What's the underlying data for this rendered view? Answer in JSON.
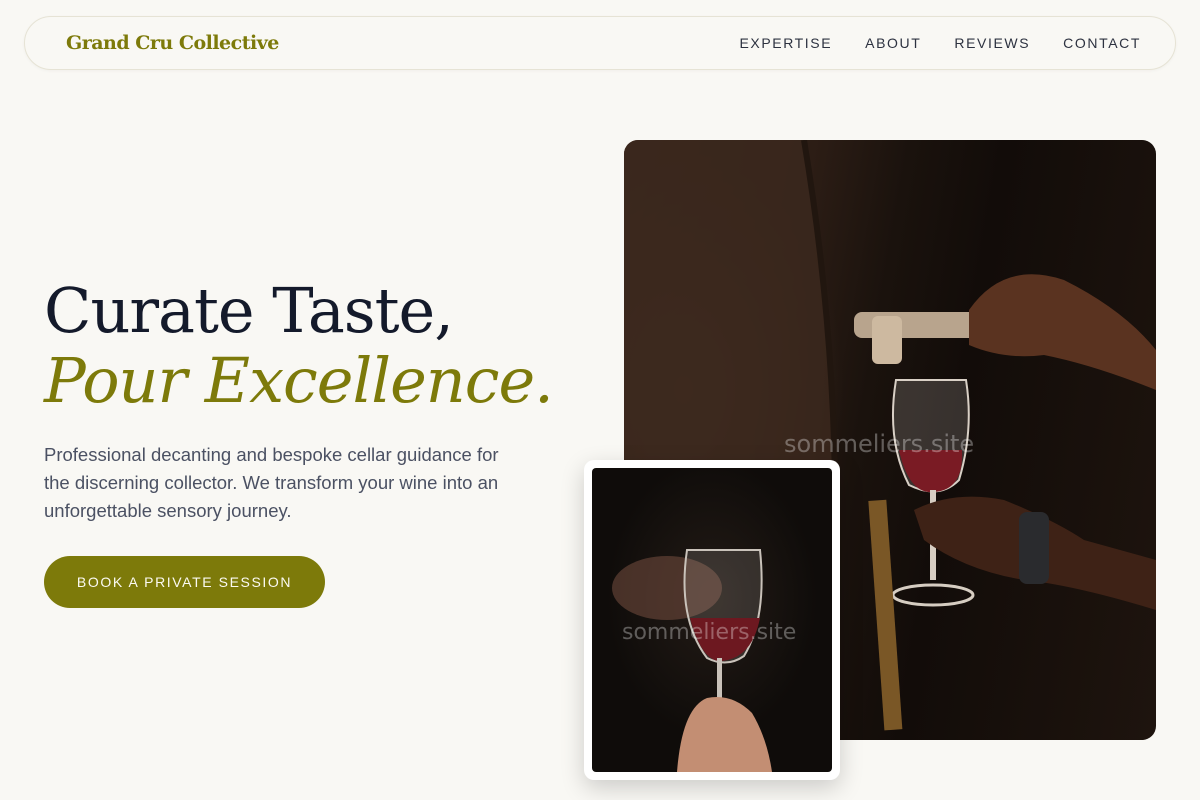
{
  "nav": {
    "brand": "Grand Cru Collective",
    "links": [
      "EXPERTISE",
      "ABOUT",
      "REVIEWS",
      "CONTACT"
    ]
  },
  "hero": {
    "headline_line1": "Curate Taste,",
    "headline_line2": "Pour Excellence.",
    "subtitle": "Professional decanting and bespoke cellar guidance for the discerning collector. We transform your wine into an unforgettable sensory journey.",
    "cta_label": "BOOK A PRIVATE SESSION"
  },
  "images": {
    "large_watermark": "sommeliers.site",
    "small_watermark": "sommeliers.site"
  },
  "colors": {
    "background": "#f9f8f4",
    "accent": "#7d7a0a",
    "headline": "#141a2b",
    "body_text": "#4b5163"
  }
}
